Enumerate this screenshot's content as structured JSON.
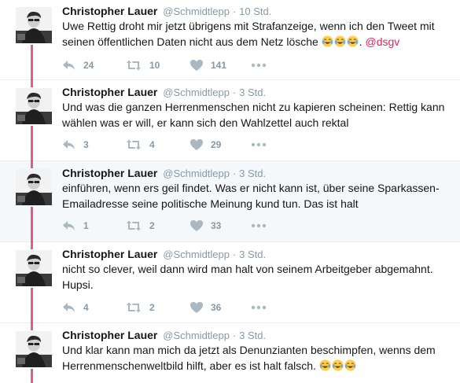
{
  "tweets": [
    {
      "name": "Christopher Lauer",
      "handle": "@Schmidtlepp",
      "dot": "·",
      "time": "10 Std.",
      "line1": "Uwe Rettig droht mir jetzt übrigens mit Strafanzeige, wenn ich den Tweet mit",
      "line2": "seinen öffentlichen Daten nicht aus dem Netz lösche",
      "mention_sep": ". ",
      "mention": "@dsgv",
      "replies": "24",
      "retweets": "10",
      "likes": "141"
    },
    {
      "name": "Christopher Lauer",
      "handle": "@Schmidtlepp",
      "dot": "·",
      "time": "3 Std.",
      "line1": "Und was die ganzen Herrenmenschen nicht zu kapieren scheinen: Rettig kann",
      "line2": "wählen was er will, er kann sich den Wahlzettel auch rektal",
      "replies": "3",
      "retweets": "4",
      "likes": "29"
    },
    {
      "name": "Christopher Lauer",
      "handle": "@Schmidtlepp",
      "dot": "·",
      "time": "3 Std.",
      "line1": "einführen, wenn ers geil findet. Was er nicht kann ist, über seine Sparkassen-",
      "line2": "Emailadresse seine politische Meinung kund tun. Das ist halt",
      "replies": "1",
      "retweets": "2",
      "likes": "33"
    },
    {
      "name": "Christopher Lauer",
      "handle": "@Schmidtlepp",
      "dot": "·",
      "time": "3 Std.",
      "line1": "nicht so clever, weil dann wird man halt von seinem Arbeitgeber abgemahnt.",
      "line2": "Hupsi.",
      "replies": "4",
      "retweets": "2",
      "likes": "36"
    },
    {
      "name": "Christopher Lauer",
      "handle": "@Schmidtlepp",
      "dot": "·",
      "time": "3 Std.",
      "line1": "Und klar kann man mich da jetzt als Denunzianten beschimpfen, wenns dem",
      "line2": "Herrenmenschenweltbild hilft, aber es ist halt falsch."
    }
  ],
  "icons": {
    "reply": "reply-icon",
    "retweet": "retweet-icon",
    "like": "heart-icon",
    "more": "more-icon",
    "emoji": "tears-of-joy-emoji"
  },
  "colors": {
    "thread_line": "#e0245e",
    "mention": "#e0245e",
    "muted": "#8899a6",
    "highlight_bg": "#f5f8fa"
  }
}
